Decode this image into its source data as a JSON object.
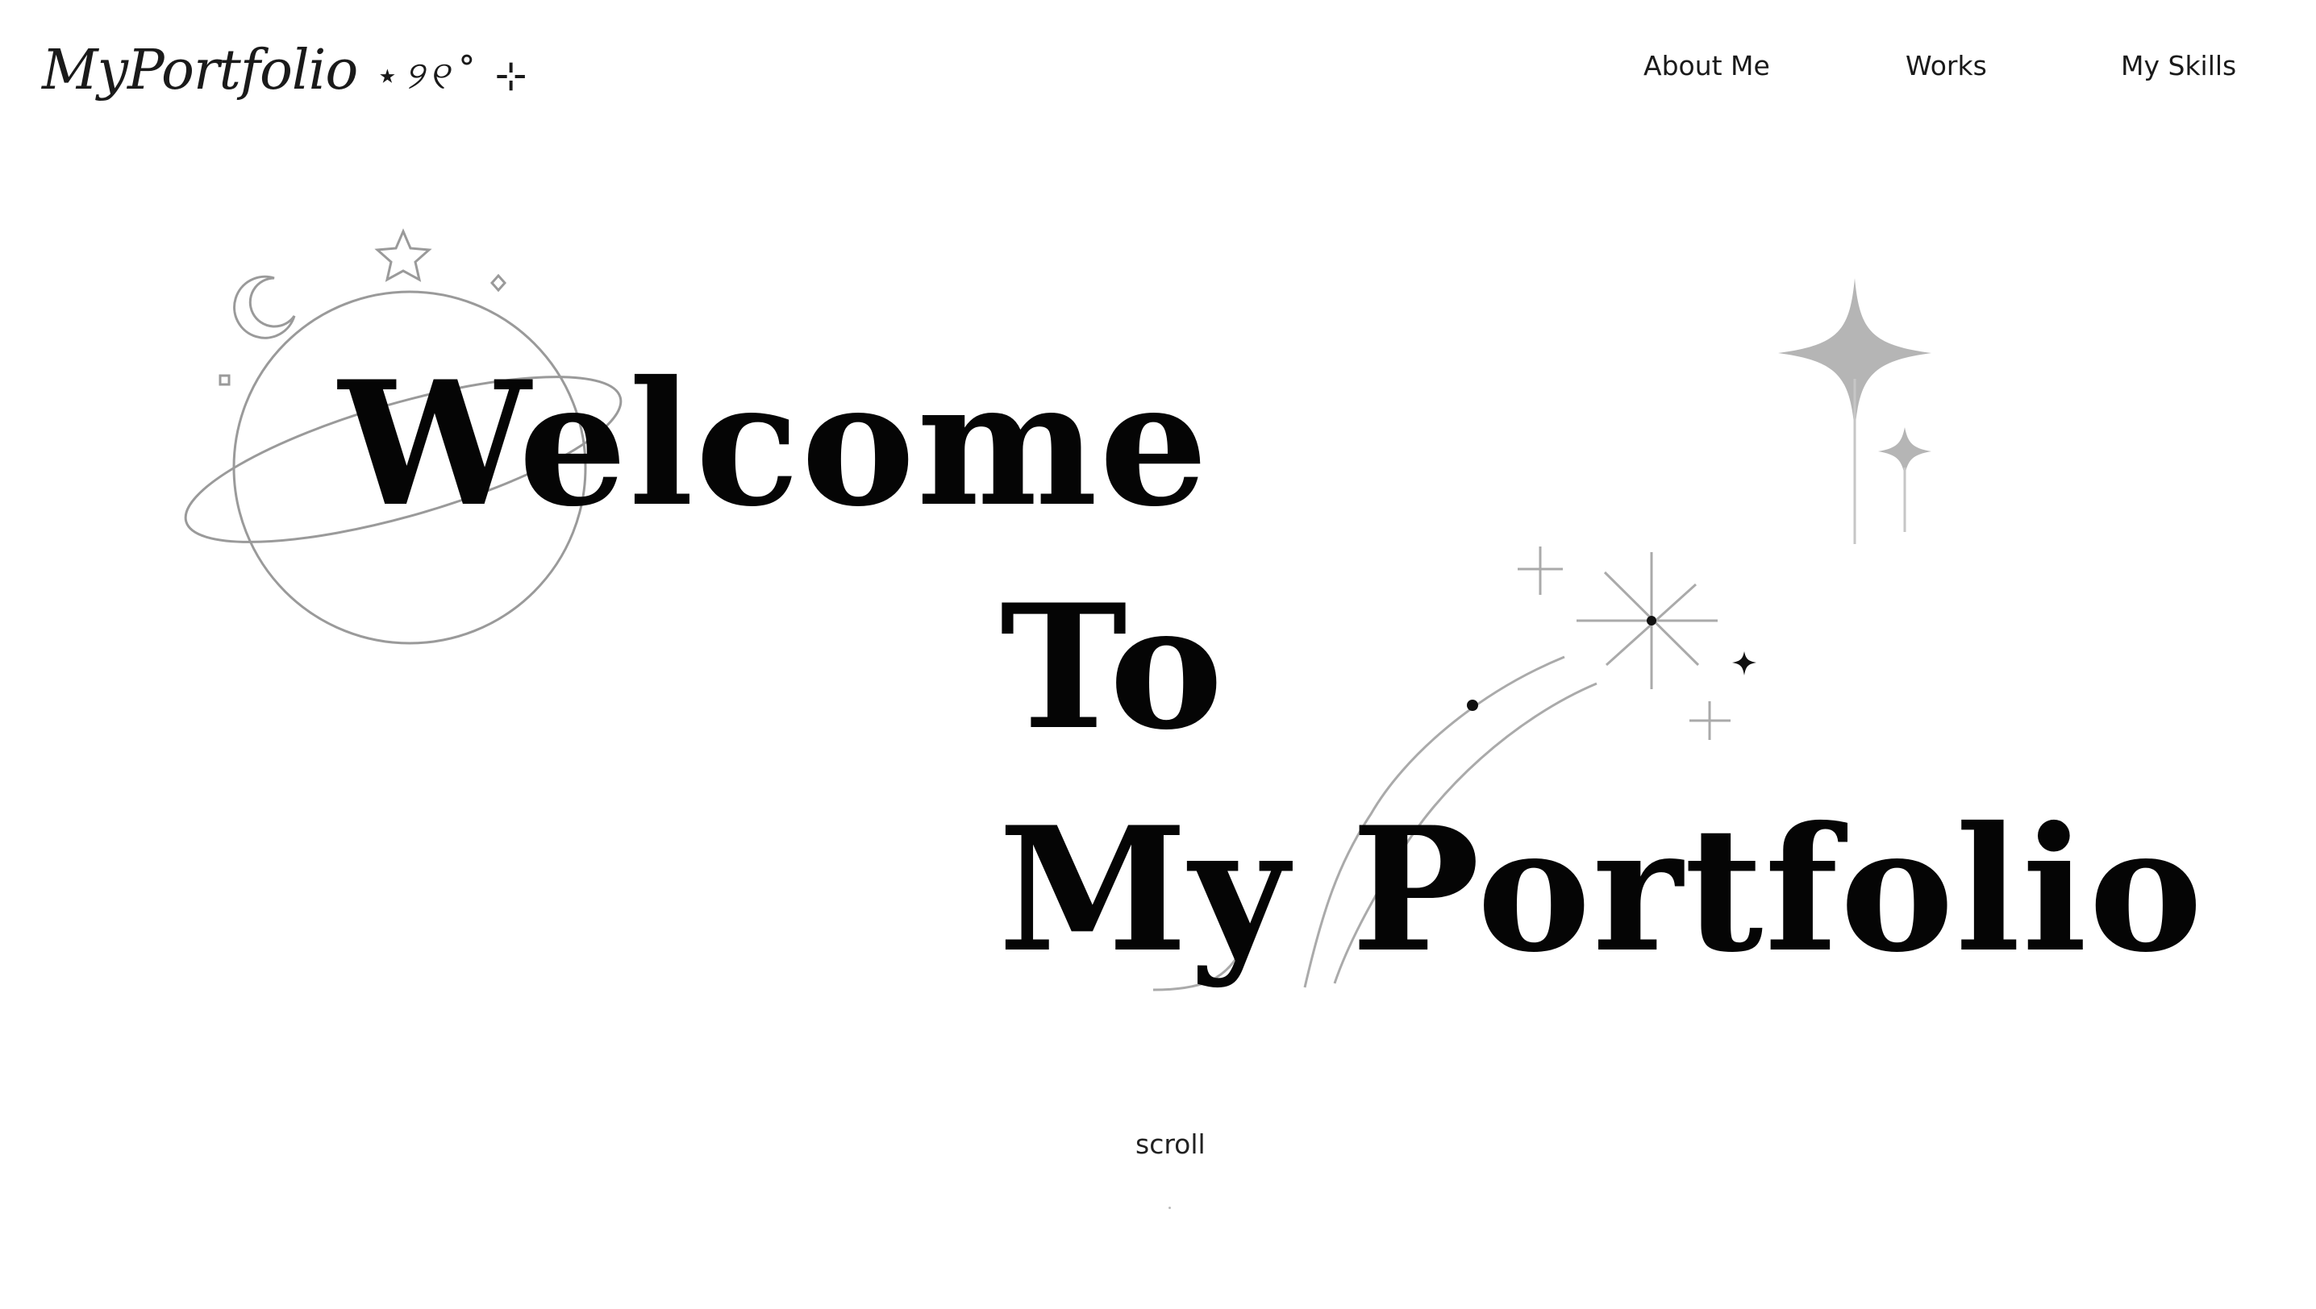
{
  "header": {
    "logo_text": "MyPortfolio",
    "logo_decoration": "⋆୨୧˚ ⊹"
  },
  "nav": {
    "items": [
      {
        "label": "About Me"
      },
      {
        "label": "Works"
      },
      {
        "label": "My Skills"
      }
    ]
  },
  "hero": {
    "line1": "Welcome",
    "line2": "To",
    "line3": "My Portfolio"
  },
  "scroll": {
    "label": "scroll"
  },
  "icons": {
    "planet": "planet-icon",
    "moon": "crescent-moon-icon",
    "star": "star-outline-icon",
    "sparkle": "four-point-sparkle-icon",
    "shooting_star": "shooting-star-icon"
  },
  "colors": {
    "text": "#050505",
    "line_art": "#9a9a9a",
    "sparkle_fill": "#b5b5b5",
    "background": "#ffffff"
  }
}
